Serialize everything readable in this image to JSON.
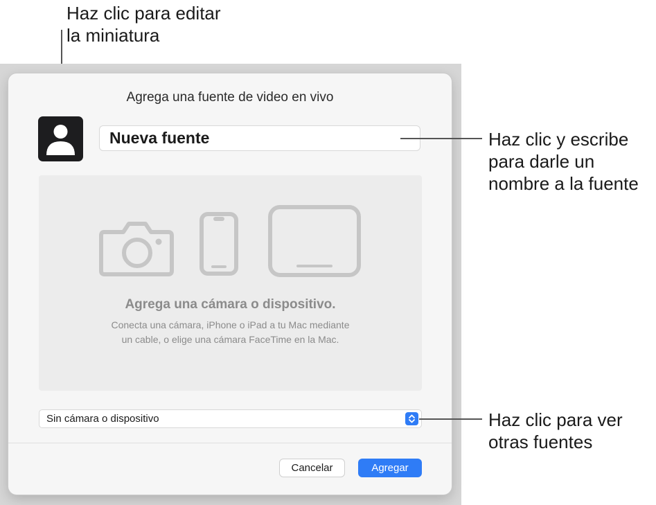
{
  "callouts": {
    "thumbnail": [
      "Haz clic para editar",
      "la miniatura"
    ],
    "name": [
      "Haz clic y escribe",
      "para darle un",
      "nombre a la fuente"
    ],
    "sources": [
      "Haz clic para ver",
      "otras fuentes"
    ]
  },
  "dialog": {
    "title": "Agrega una fuente de video en vivo",
    "thumbnail_icon": "person-silhouette-icon",
    "name_value": "Nueva fuente",
    "drop_area": {
      "icons": [
        "camera-icon",
        "iphone-icon",
        "ipad-icon"
      ],
      "title": "Agrega una cámara o dispositivo.",
      "description": [
        "Conecta una cámara, iPhone o iPad a tu Mac mediante",
        "un cable, o elige una cámara FaceTime en la Mac."
      ]
    },
    "source_select": {
      "selected": "Sin cámara o dispositivo",
      "icon": "chevron-up-down-icon"
    },
    "buttons": {
      "cancel": "Cancelar",
      "add": "Agregar"
    }
  },
  "colors": {
    "accent": "#2f7cf6",
    "placeholder_gray": "#8b8b8b"
  }
}
